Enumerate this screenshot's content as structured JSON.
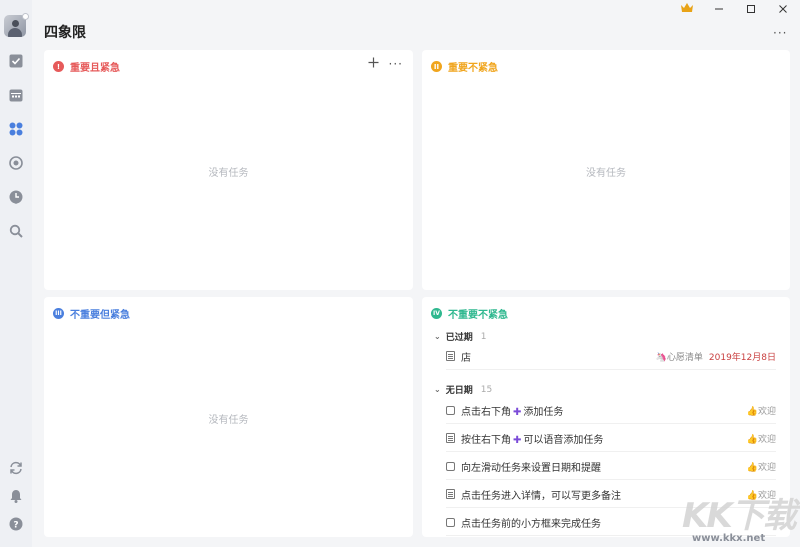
{
  "app": {
    "title": "四象限"
  },
  "colors": {
    "q1": "#e65a5a",
    "q2": "#f0a51e",
    "q3": "#4a7fde",
    "q4": "#2fb88f",
    "accent": "#4a7fde"
  },
  "sidebar": {
    "items": [
      {
        "name": "task-icon"
      },
      {
        "name": "calendar-icon"
      },
      {
        "name": "quadrant-icon"
      },
      {
        "name": "pomodoro-icon"
      },
      {
        "name": "habit-icon"
      },
      {
        "name": "search-icon"
      }
    ],
    "bottom": [
      {
        "name": "sync-icon"
      },
      {
        "name": "bell-icon"
      },
      {
        "name": "help-icon"
      }
    ]
  },
  "quadrants": {
    "q1": {
      "badge": "!",
      "title": "重要且紧急",
      "empty": "没有任务"
    },
    "q2": {
      "badge": "II",
      "title": "重要不紧急",
      "empty": "没有任务"
    },
    "q3": {
      "badge": "III",
      "title": "不重要但紧急",
      "empty": "没有任务"
    },
    "q4": {
      "badge": "IV",
      "title": "不重要不紧急",
      "groups": [
        {
          "label": "已过期",
          "count": "1"
        },
        {
          "label": "无日期",
          "count": "15"
        }
      ],
      "tasks": [
        {
          "text": "店",
          "list": "心愿清单",
          "date": "2019年12月8日"
        },
        {
          "pre": "点击右下角",
          "post": "添加任务",
          "tag": "欢迎"
        },
        {
          "pre": "按住右下角",
          "post": "可以语音添加任务",
          "tag": "欢迎"
        },
        {
          "text": "向左滑动任务来设置日期和提醒",
          "tag": "欢迎"
        },
        {
          "text": "点击任务进入详情，可以写更多备注",
          "tag": "欢迎"
        },
        {
          "text": "点击任务前的小方框来完成任务"
        }
      ]
    }
  },
  "watermark": {
    "logo": "KK下载",
    "url": "www.kkx.net"
  }
}
